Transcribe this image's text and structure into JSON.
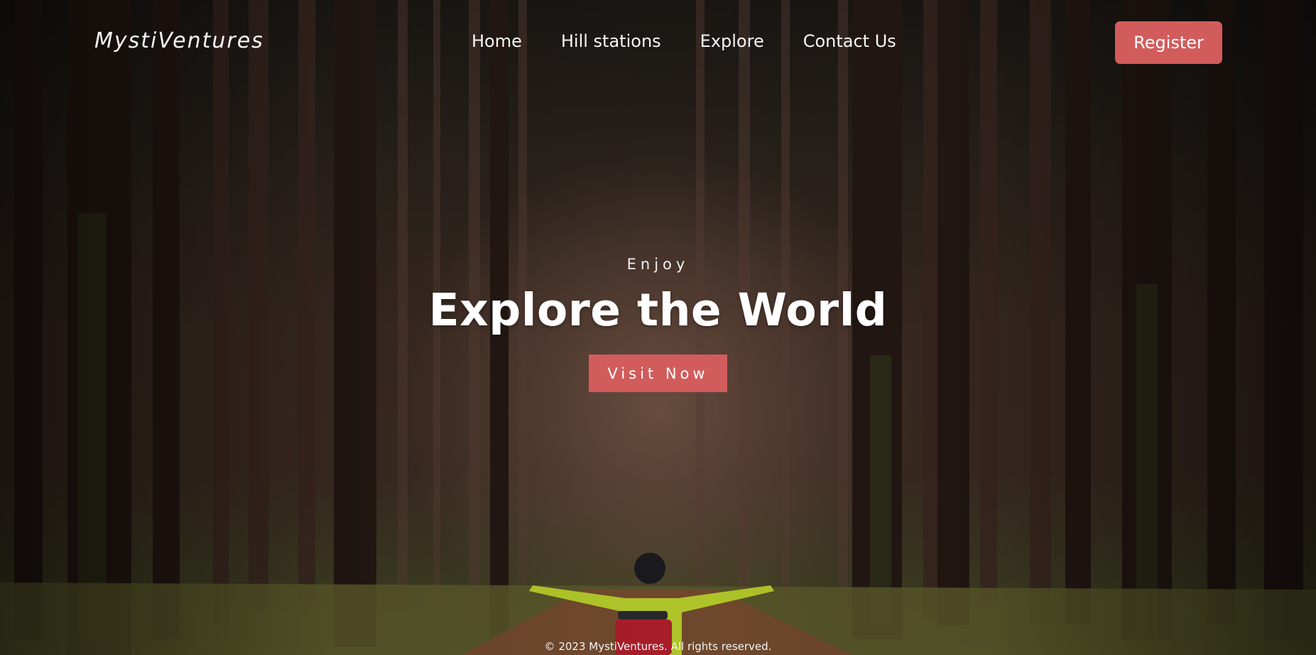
{
  "brand": {
    "name": "MystiVentures"
  },
  "nav": {
    "links": [
      {
        "label": "Home"
      },
      {
        "label": "Hill stations"
      },
      {
        "label": "Explore"
      },
      {
        "label": "Contact Us"
      }
    ],
    "register_label": "Register"
  },
  "hero": {
    "eyebrow": "Enjoy",
    "title": "Explore the World",
    "cta_label": "Visit Now",
    "background": "forest-path-hiker-photo"
  },
  "footer": {
    "copyright": "© 2023 MystiVentures. All rights reserved."
  },
  "colors": {
    "accent": "#d25c5c",
    "text": "#ffffff"
  }
}
